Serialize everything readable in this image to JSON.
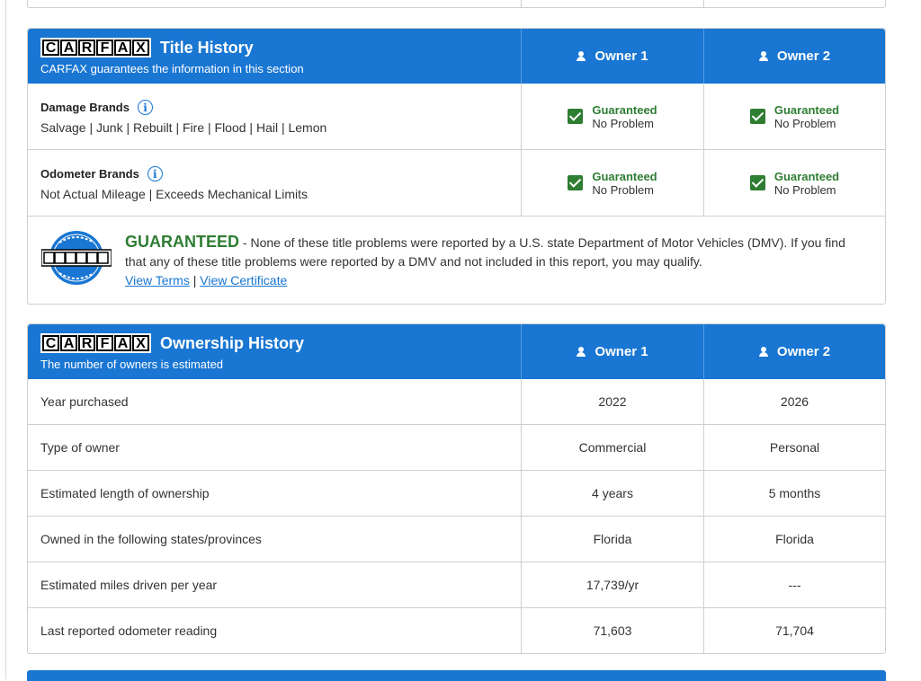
{
  "colors": {
    "header_blue": "#1976d2",
    "guarantee_green": "#2e7d32"
  },
  "logo_letters": [
    "C",
    "A",
    "R",
    "F",
    "A",
    "X"
  ],
  "title_history": {
    "title": "Title History",
    "subtitle": "CARFAX guarantees the information in this section",
    "owner_headers": [
      "Owner 1",
      "Owner 2"
    ],
    "rows": [
      {
        "title": "Damage Brands",
        "subtitle": "Salvage | Junk | Rebuilt | Fire | Flood | Hail | Lemon",
        "values": [
          {
            "status": "Guaranteed",
            "detail": "No Problem"
          },
          {
            "status": "Guaranteed",
            "detail": "No Problem"
          }
        ]
      },
      {
        "title": "Odometer Brands",
        "subtitle": "Not Actual Mileage | Exceeds Mechanical Limits",
        "values": [
          {
            "status": "Guaranteed",
            "detail": "No Problem"
          },
          {
            "status": "Guaranteed",
            "detail": "No Problem"
          }
        ]
      }
    ],
    "guarantee": {
      "heading": "GUARANTEED",
      "text": " - None of these title problems were reported by a U.S. state Department of Motor Vehicles (DMV). If you find that any of these title problems were reported by a DMV and not included in this report, you may qualify.",
      "link_terms": "View Terms",
      "separator": "|",
      "link_certificate": "View Certificate"
    }
  },
  "ownership_history": {
    "title": "Ownership History",
    "subtitle": "The number of owners is estimated",
    "owner_headers": [
      "Owner 1",
      "Owner 2"
    ],
    "rows": [
      {
        "label": "Year purchased",
        "values": [
          "2022",
          "2026"
        ]
      },
      {
        "label": "Type of owner",
        "values": [
          "Commercial",
          "Personal"
        ]
      },
      {
        "label": "Estimated length of ownership",
        "values": [
          "4 years",
          "5 months"
        ]
      },
      {
        "label": "Owned in the following states/provinces",
        "values": [
          "Florida",
          "Florida"
        ]
      },
      {
        "label": "Estimated miles driven per year",
        "values": [
          "17,739/yr",
          "---"
        ]
      },
      {
        "label": "Last reported odometer reading",
        "values": [
          "71,603",
          "71,704"
        ]
      }
    ]
  }
}
